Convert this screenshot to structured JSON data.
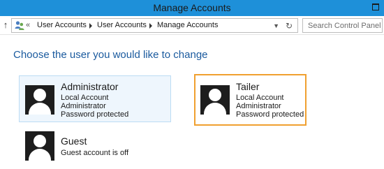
{
  "window": {
    "title": "Manage Accounts"
  },
  "navigation": {
    "address_prefix": "«",
    "breadcrumbs": [
      "User Accounts",
      "User Accounts",
      "Manage Accounts"
    ],
    "search_placeholder": "Search Control Panel"
  },
  "main": {
    "heading": "Choose the user you would like to change",
    "accounts": [
      {
        "name": "Administrator",
        "details": [
          "Local Account",
          "Administrator",
          "Password protected"
        ],
        "state": "selected"
      },
      {
        "name": "Tailer",
        "details": [
          "Local Account",
          "Administrator",
          "Password protected"
        ],
        "state": "focused"
      },
      {
        "name": "Guest",
        "details": [
          "Guest account is off"
        ],
        "state": "normal"
      }
    ]
  },
  "colors": {
    "titlebar": "#1e90d9",
    "heading": "#1a5a9e",
    "focus_border": "#f0a030",
    "selected_bg": "#eef6fd"
  }
}
